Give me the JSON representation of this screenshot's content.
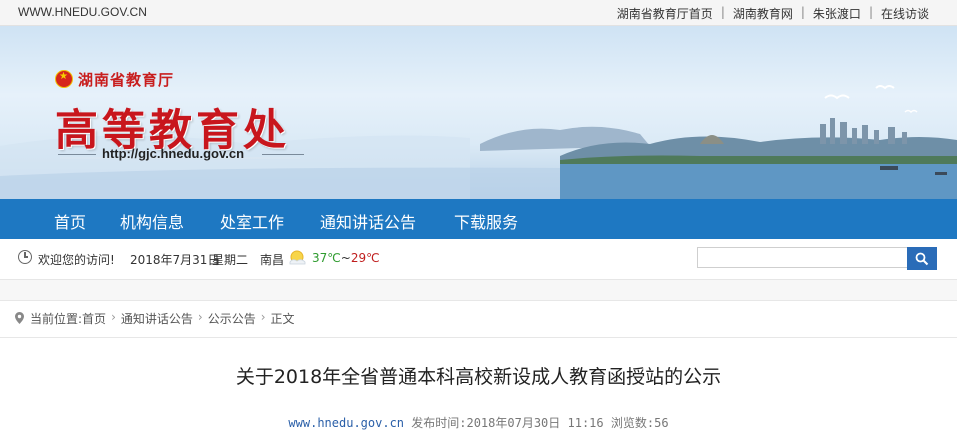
{
  "topbar": {
    "site_url": "WWW.HNEDU.GOV.CN",
    "links": [
      "湖南省教育厅首页",
      "湖南教育网",
      "朱张渡口",
      "在线访谈"
    ]
  },
  "banner": {
    "department": "湖南省教育厅",
    "office": "高等教育处",
    "url": "http://gjc.hnedu.gov.cn"
  },
  "nav": {
    "items": [
      "首页",
      "机构信息",
      "处室工作",
      "通知讲话公告",
      "下载服务"
    ],
    "background": "#1e78c2"
  },
  "infobar": {
    "welcome": "欢迎您的访问!",
    "date": "2018年7月31日",
    "weekday": "星期二",
    "city": "南昌",
    "temp_low": "37℃",
    "temp_sep": "~",
    "temp_high": "29℃",
    "search_value": ""
  },
  "breadcrumb": {
    "prefix": "当前位置:",
    "items": [
      "首页",
      "通知讲话公告",
      "公示公告",
      "正文"
    ]
  },
  "article": {
    "title": "关于2018年全省普通本科高校新设成人教育函授站的公示",
    "source": "www.hnedu.gov.cn",
    "published_label": "发布时间:",
    "published": "2018年07月30日 11:16",
    "views_label": "浏览数:",
    "views": "56"
  }
}
